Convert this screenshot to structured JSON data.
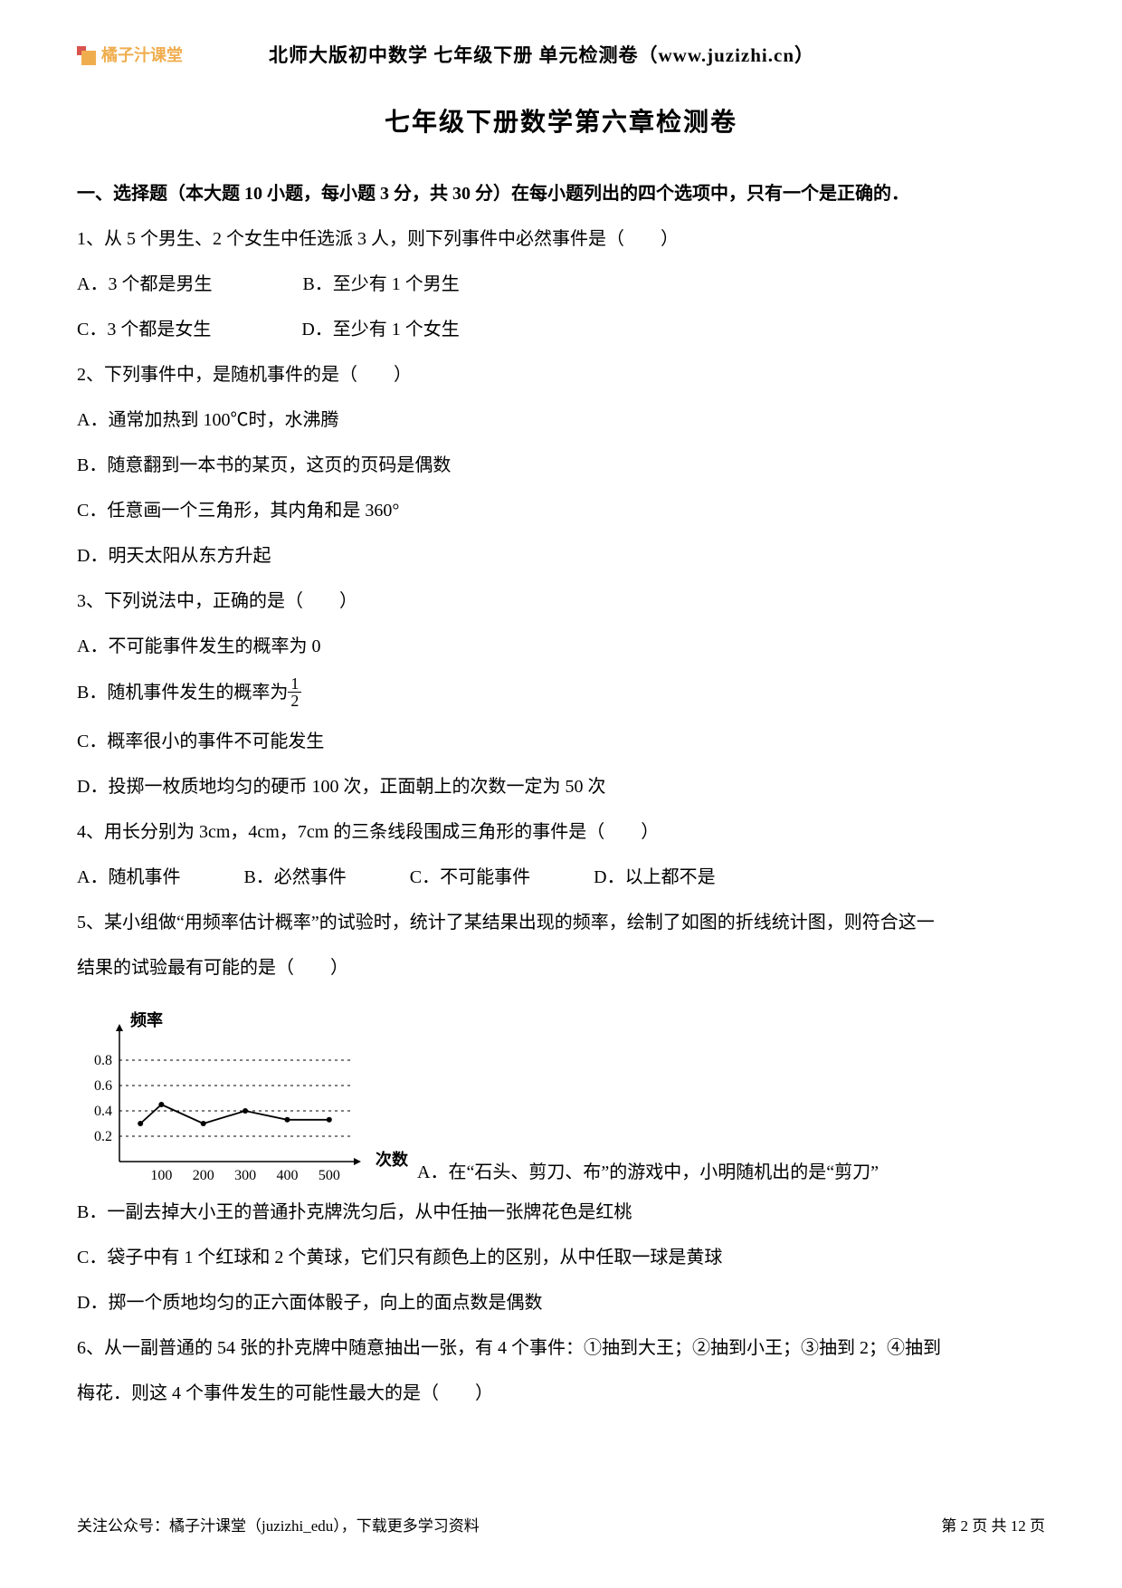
{
  "header": {
    "logo_text": "橘子汁课堂",
    "title": "北师大版初中数学 七年级下册 单元检测卷（www.juzizhi.cn）"
  },
  "main_title": "七年级下册数学第六章检测卷",
  "section1_title": "一、选择题（本大题 10 小题，每小题 3 分，共 30 分）在每小题列出的四个选项中，只有一个是正确的．",
  "q1": {
    "stem": "1、从 5 个男生、2 个女生中任选派 3 人，则下列事件中必然事件是（　　）",
    "a": "A．3 个都是男生",
    "b": "B．至少有 1 个男生",
    "c": "C．3 个都是女生",
    "d": "D．至少有 1 个女生"
  },
  "q2": {
    "stem": "2、下列事件中，是随机事件的是（　　）",
    "a": "A．通常加热到 100℃时，水沸腾",
    "b": "B．随意翻到一本书的某页，这页的页码是偶数",
    "c": "C．任意画一个三角形，其内角和是 360°",
    "d": "D．明天太阳从东方升起"
  },
  "q3": {
    "stem": "3、下列说法中，正确的是（　　）",
    "a": "A．不可能事件发生的概率为 0",
    "b_prefix": "B．随机事件发生的概率为",
    "frac_num": "1",
    "frac_den": "2",
    "c": "C．概率很小的事件不可能发生",
    "d": "D．投掷一枚质地均匀的硬币 100 次，正面朝上的次数一定为 50 次"
  },
  "q4": {
    "stem": "4、用长分别为 3cm，4cm，7cm 的三条线段围成三角形的事件是（　　）",
    "a": "A．随机事件",
    "b": "B．必然事件",
    "c": "C．不可能事件",
    "d": "D．以上都不是"
  },
  "q5": {
    "stem1": "5、某小组做“用频率估计概率”的试验时，统计了某结果出现的频率，绘制了如图的折线统计图，则符合这一",
    "stem2": "结果的试验最有可能的是（　　）",
    "a": "A．在“石头、剪刀、布”的游戏中，小明随机出的是“剪刀”",
    "b": "B．一副去掉大小王的普通扑克牌洗匀后，从中任抽一张牌花色是红桃",
    "c": "C．袋子中有 1 个红球和 2 个黄球，它们只有颜色上的区别，从中任取一球是黄球",
    "d": "D．掷一个质地均匀的正六面体骰子，向上的面点数是偶数"
  },
  "q6": {
    "stem1": "6、从一副普通的 54 张的扑克牌中随意抽出一张，有 4 个事件：①抽到大王；②抽到小王；③抽到 2；④抽到",
    "stem2": "梅花．则这 4 个事件发生的可能性最大的是（　　）"
  },
  "chart_data": {
    "type": "line",
    "ylabel": "频率",
    "xlabel": "次数",
    "xlim": [
      0,
      550
    ],
    "ylim": [
      0,
      1.0
    ],
    "y_ticks": [
      0.2,
      0.4,
      0.6,
      0.8
    ],
    "x_ticks": [
      100,
      200,
      300,
      400,
      500
    ],
    "series": [
      {
        "name": "frequency",
        "x": [
          50,
          100,
          200,
          300,
          400,
          500
        ],
        "values": [
          0.3,
          0.45,
          0.3,
          0.4,
          0.33,
          0.33
        ]
      }
    ],
    "guideline_y": 0.333
  },
  "footer": {
    "left": "关注公众号：橘子汁课堂（juzizhi_edu），下载更多学习资料",
    "right": "第 2 页 共 12 页"
  }
}
